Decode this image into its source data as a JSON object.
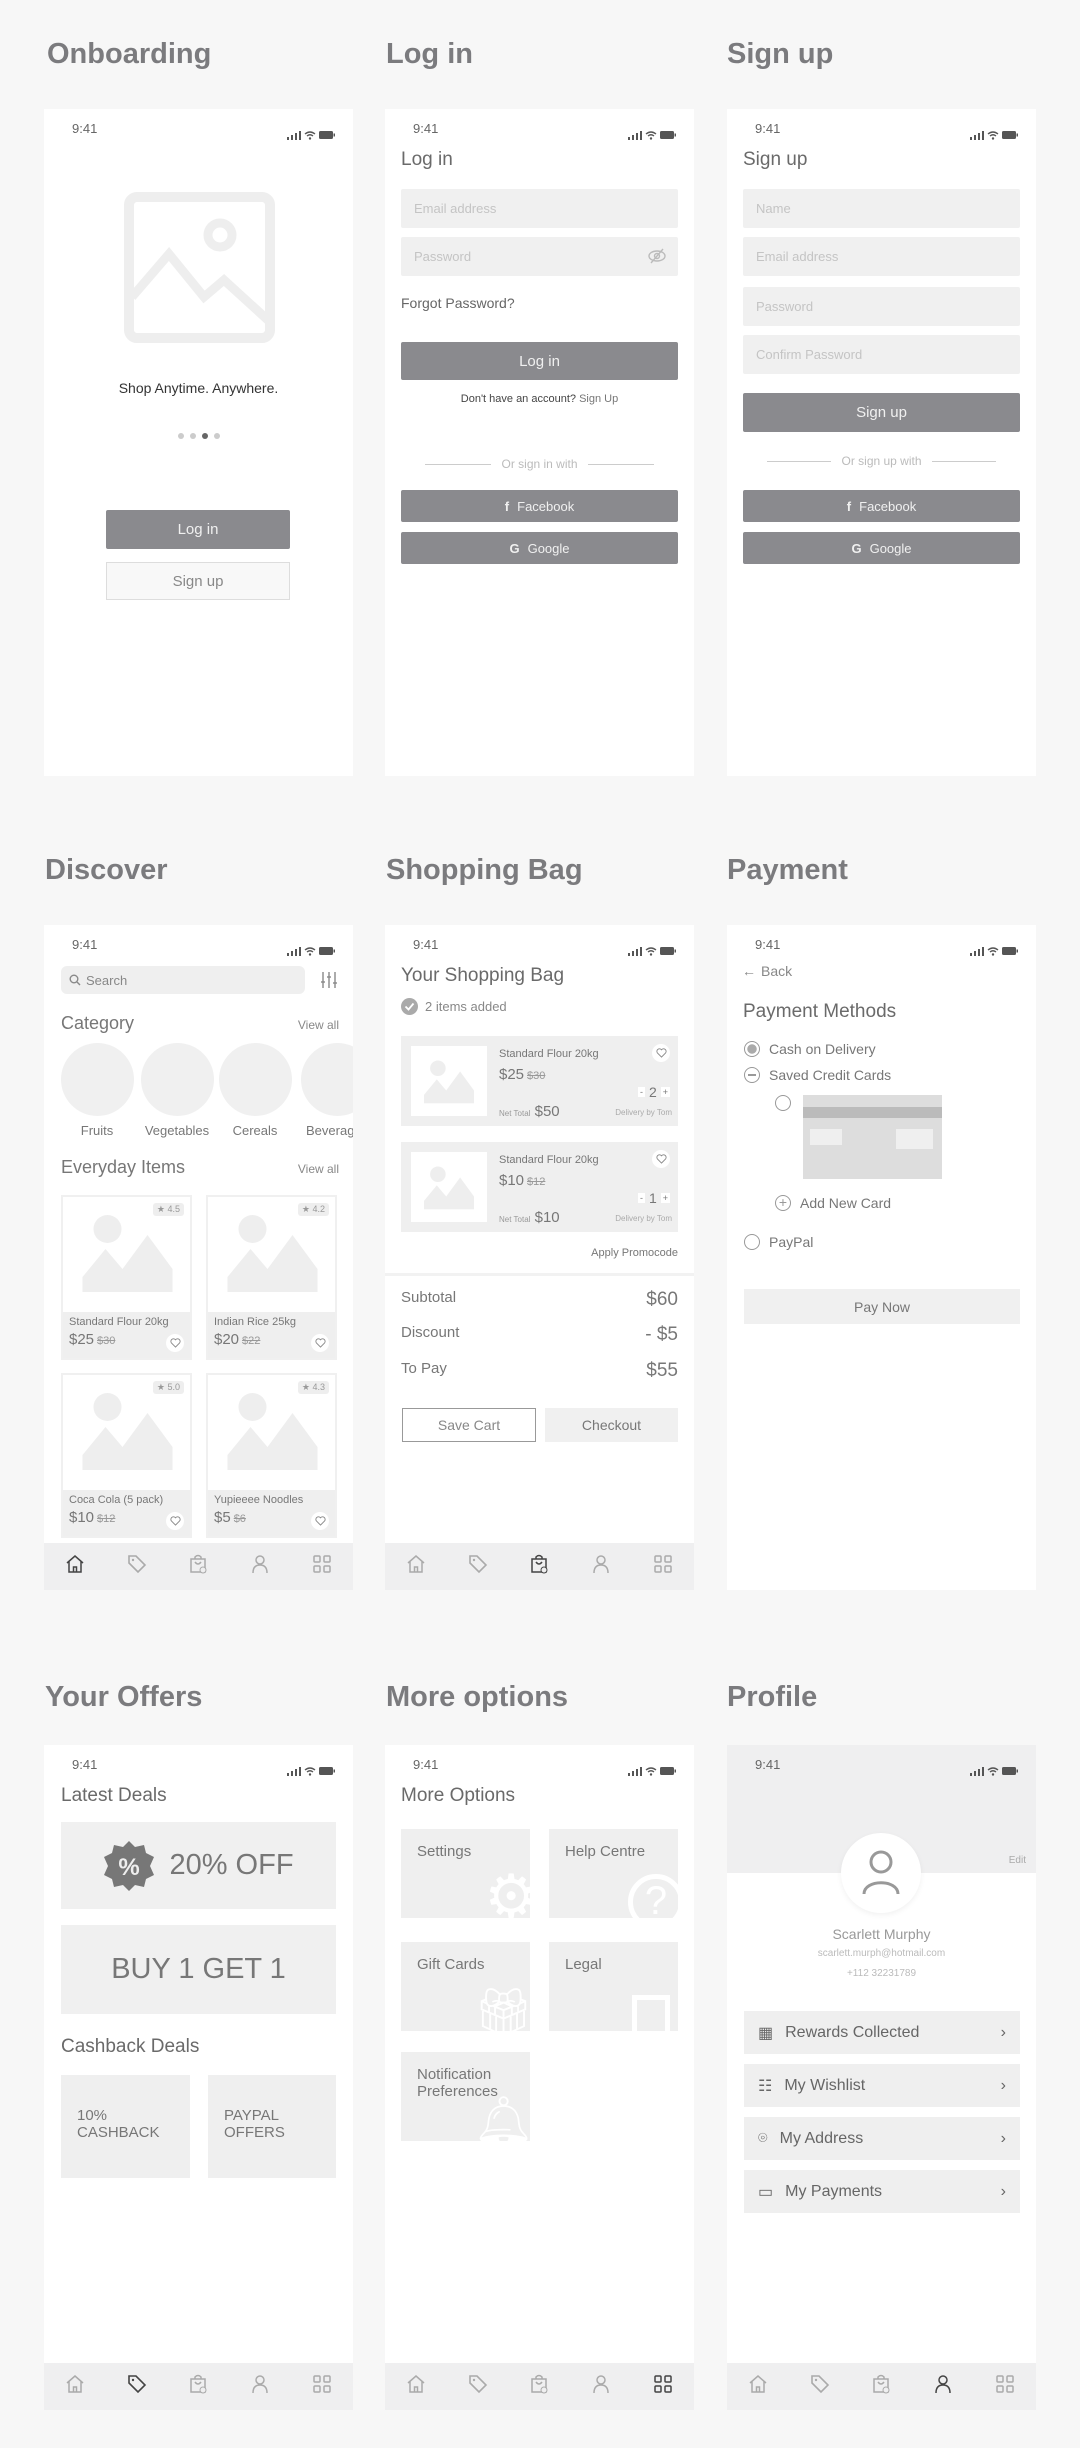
{
  "status": {
    "time": "9:41"
  },
  "colors": {
    "background": "#f7f7f7",
    "button": "#8a8a8e",
    "field": "#f0f0f0"
  },
  "onboarding": {
    "heading": "Onboarding",
    "tagline": "Shop Anytime. Anywhere.",
    "page_dots": 4,
    "active_dot": 3,
    "login": "Log in",
    "signup": "Sign up"
  },
  "login": {
    "heading": "Log in",
    "title": "Log in",
    "email_placeholder": "Email address",
    "password_placeholder": "Password",
    "forgot": "Forgot Password?",
    "button": "Log in",
    "no_account": "Don't have an account?",
    "signup_link": "Sign Up",
    "divider": "Or sign in with",
    "facebook": "Facebook",
    "google": "Google"
  },
  "signup": {
    "heading": "Sign up",
    "title": "Sign up",
    "name_placeholder": "Name",
    "email_placeholder": "Email address",
    "password_placeholder": "Password",
    "confirm_placeholder": "Confirm Password",
    "button": "Sign up",
    "divider": "Or sign up with",
    "facebook": "Facebook",
    "google": "Google"
  },
  "discover": {
    "heading": "Discover",
    "search_placeholder": "Search",
    "category_title": "Category",
    "view_all": "View all",
    "categories": [
      "Fruits",
      "Vegetables",
      "Cereals",
      "Beverages"
    ],
    "everyday_title": "Everyday Items",
    "items": [
      {
        "name": "Standard Flour 20kg",
        "price": "$25",
        "old_price": "$30",
        "rating": "4.5"
      },
      {
        "name": "Indian Rice 25kg",
        "price": "$20",
        "old_price": "$22",
        "rating": "4.2"
      },
      {
        "name": "Coca Cola (5 pack)",
        "price": "$10",
        "old_price": "$12",
        "rating": "5.0"
      },
      {
        "name": "Yupieeee Noodles",
        "price": "$5",
        "old_price": "$6",
        "rating": "4.3"
      }
    ],
    "nav_active": "home"
  },
  "bag": {
    "heading": "Shopping Bag",
    "title": "Your Shopping Bag",
    "added": "2 items added",
    "items": [
      {
        "name": "Standard Flour 20kg",
        "price": "$25",
        "old_price": "$30",
        "qty": "2",
        "net_label": "Net Total",
        "net": "$50",
        "delivery": "Delivery by Tom"
      },
      {
        "name": "Standard Flour 20kg",
        "price": "$10",
        "old_price": "$12",
        "qty": "1",
        "net_label": "Net Total",
        "net": "$10",
        "delivery": "Delivery by Tom"
      }
    ],
    "promo": "Apply Promocode",
    "summary": [
      {
        "label": "Subtotal",
        "value": "$60"
      },
      {
        "label": "Discount",
        "value": "- $5"
      },
      {
        "label": "To Pay",
        "value": "$55"
      }
    ],
    "save": "Save Cart",
    "checkout": "Checkout",
    "nav_active": "bag"
  },
  "payment": {
    "heading": "Payment",
    "back": "Back",
    "title": "Payment Methods",
    "cash": "Cash on Delivery",
    "saved": "Saved Credit Cards",
    "add_card": "Add New Card",
    "paypal": "PayPal",
    "pay": "Pay Now",
    "selected": "Cash on Delivery"
  },
  "offers": {
    "heading": "Your Offers",
    "latest": "Latest Deals",
    "deal1": "20% OFF",
    "deal2": "BUY 1 GET 1",
    "cashback_title": "Cashback Deals",
    "cashback": [
      "10%\nCASHBACK",
      "PAYPAL\nOFFERS"
    ],
    "nav_active": "offers"
  },
  "more": {
    "heading": "More options",
    "title": "More Options",
    "tiles": [
      "Settings",
      "Help Centre",
      "Gift Cards",
      "Legal",
      "Notification\nPreferences"
    ],
    "nav_active": "more"
  },
  "profile": {
    "heading": "Profile",
    "edit": "Edit",
    "name": "Scarlett Murphy",
    "email": "scarlett.murph@hotmail.com",
    "phone": "+112 32231789",
    "rows": [
      {
        "label": "Rewards Collected",
        "icon": "gift-icon"
      },
      {
        "label": "My Wishlist",
        "icon": "list-icon"
      },
      {
        "label": "My Address",
        "icon": "location-pin-icon"
      },
      {
        "label": "My Payments",
        "icon": "credit-card-icon"
      }
    ],
    "nav_active": "profile"
  }
}
